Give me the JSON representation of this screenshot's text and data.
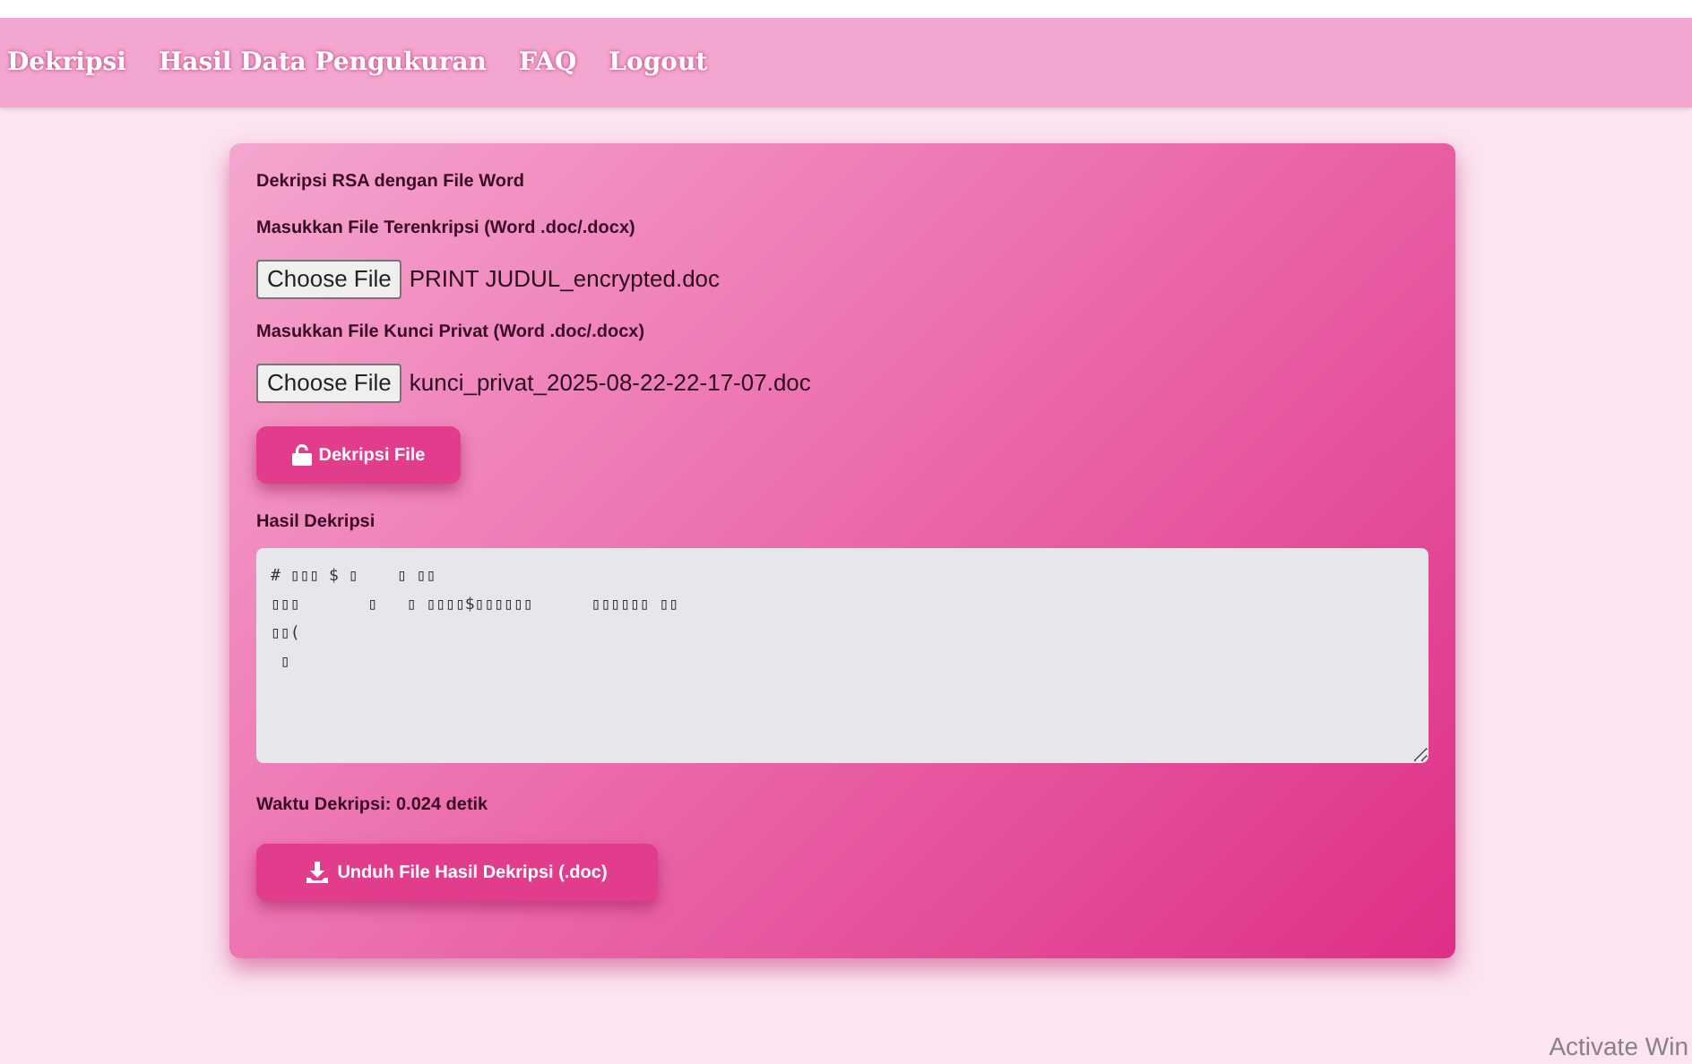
{
  "nav": {
    "items": [
      {
        "label": "Dekripsi"
      },
      {
        "label": "Hasil Data Pengukuran"
      },
      {
        "label": "FAQ"
      },
      {
        "label": "Logout"
      }
    ]
  },
  "card": {
    "title": "Dekripsi RSA dengan File Word",
    "file_inputs": [
      {
        "label": "Masukkan File Terenkripsi (Word .doc/.docx)",
        "button": "Choose File",
        "file_name": "PRINT JUDUL_encrypted.doc"
      },
      {
        "label": "Masukkan File Kunci Privat (Word .doc/.docx)",
        "button": "Choose File",
        "file_name": "kunci_privat_2025-08-22-22-17-07.doc"
      }
    ],
    "decrypt_button": "Dekripsi File",
    "result_label": "Hasil Dekripsi",
    "result_value": "# ▯▯▯ $ ▯    ▯ ▯▯\n▯▯▯       ▯   ▯ ▯▯▯▯$▯▯▯▯▯▯      ▯▯▯▯▯▯ ▯▯\n▯▯(\n ▯",
    "time": "Waktu Dekripsi: 0.024 detik",
    "download_button": "Unduh File Hasil Dekripsi (.doc)"
  },
  "os_notice": "Activate Win"
}
